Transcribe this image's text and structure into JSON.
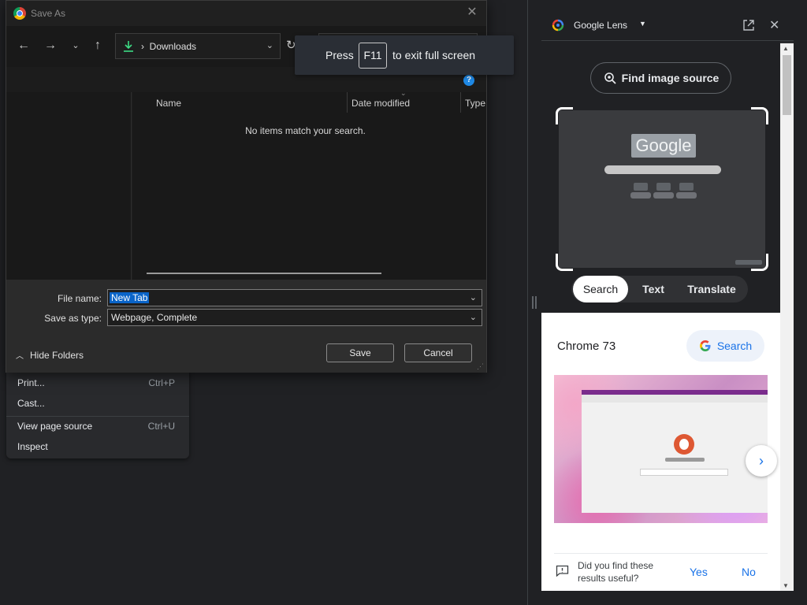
{
  "bg_menu": {
    "items": [
      {
        "label": "Print...",
        "shortcut": "Ctrl+P"
      },
      {
        "label": "Cast...",
        "shortcut": ""
      },
      {
        "label": "View page source",
        "shortcut": "Ctrl+U"
      },
      {
        "label": "Inspect",
        "shortcut": ""
      }
    ]
  },
  "dialog": {
    "title": "Save As",
    "address_crumb": "Downloads",
    "columns": [
      "Name",
      "Date modified",
      "Type"
    ],
    "empty_message": "No items match your search.",
    "file_name_label": "File name:",
    "file_name_value": "New Tab",
    "save_type_label": "Save as type:",
    "save_type_value": "Webpage, Complete",
    "hide_folders": "Hide Folders",
    "save_button": "Save",
    "cancel_button": "Cancel"
  },
  "toast": {
    "press": "Press",
    "key": "F11",
    "rest": "to exit full screen"
  },
  "lens": {
    "title": "Google Lens",
    "find_image_source": "Find image source",
    "preview_logo_text": "Google",
    "tabs": [
      "Search",
      "Text",
      "Translate"
    ],
    "active_tab": "Search",
    "result_title": "Chrome 73",
    "search_button": "Search",
    "feedback_question": "Did you find these results useful?",
    "yes": "Yes",
    "no": "No"
  },
  "colors": {
    "accent_blue": "#1a73e8",
    "selection_blue": "#0a64c8",
    "dark_bg": "#202124"
  }
}
